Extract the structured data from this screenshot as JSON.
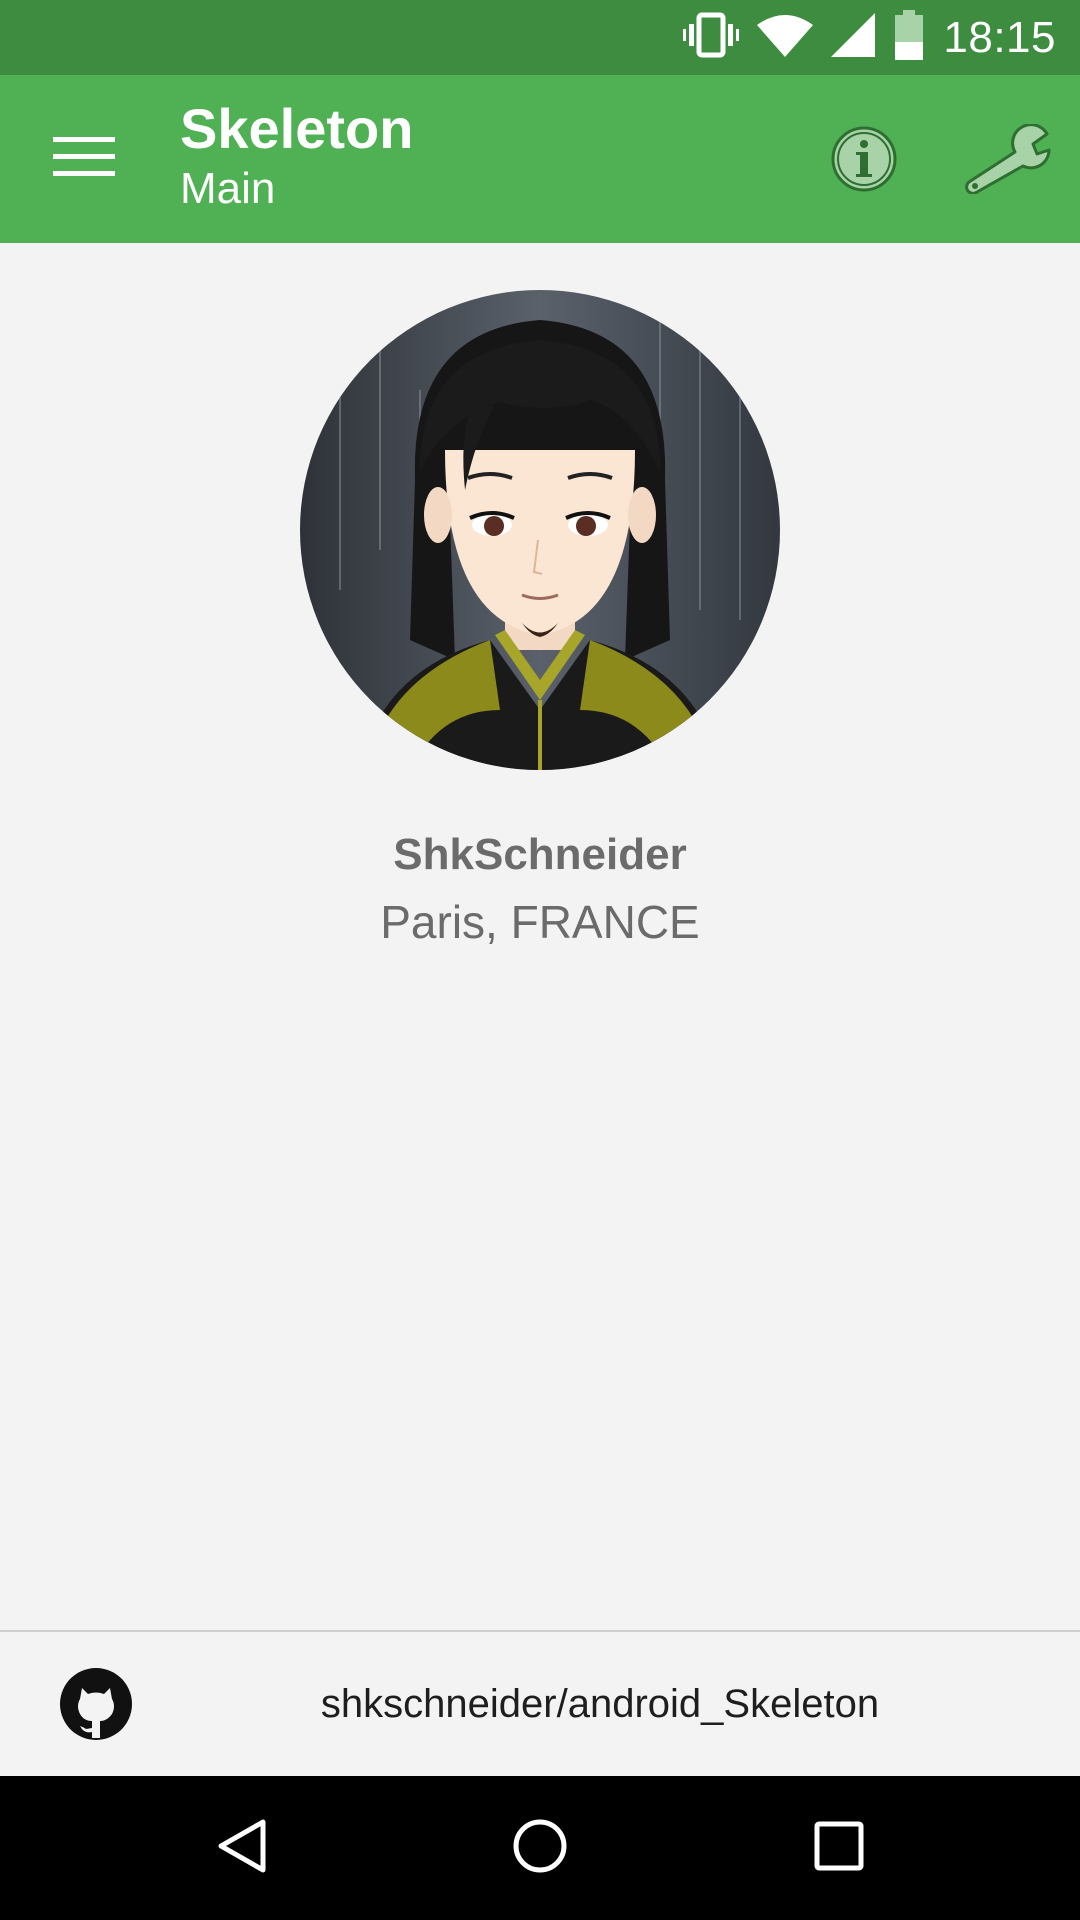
{
  "status_bar": {
    "time": "18:15",
    "icons": [
      "vibrate-icon",
      "wifi-icon",
      "signal-icon",
      "battery-icon"
    ]
  },
  "app_bar": {
    "title": "Skeleton",
    "subtitle": "Main",
    "icons": {
      "menu": "menu-icon",
      "info": "info-icon",
      "settings": "wrench-icon"
    },
    "background_color": "#4fb153",
    "status_color": "#3d8c40"
  },
  "profile": {
    "name": "ShkSchneider",
    "location": "Paris, FRANCE",
    "avatar": "avatar"
  },
  "footer": {
    "repo": "shkschneider/android_Skeleton",
    "icon": "github-icon"
  },
  "nav_bar": {
    "buttons": [
      "back-icon",
      "home-icon",
      "recents-icon"
    ]
  }
}
